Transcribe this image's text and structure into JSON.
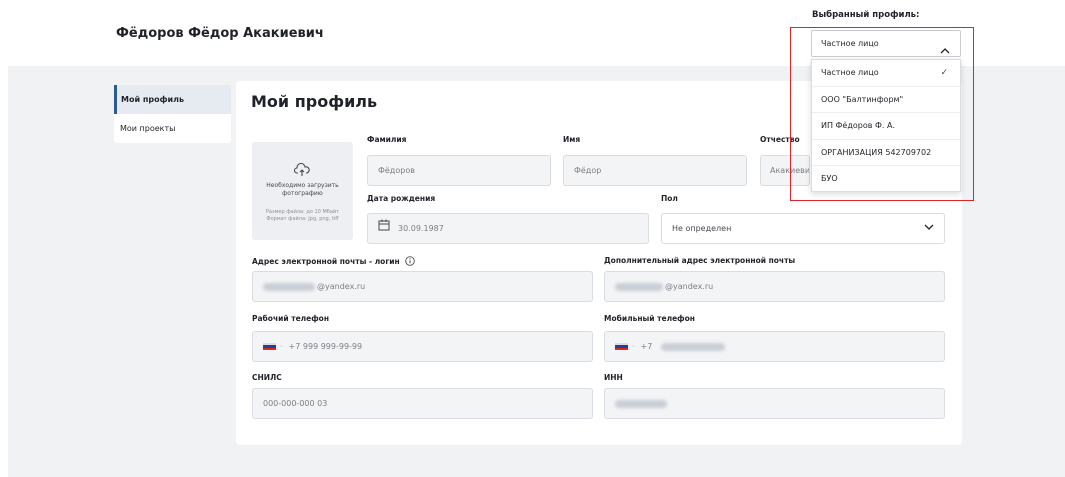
{
  "header": {
    "user_name": "Фёдоров Фёдор Акакиевич",
    "profile_label": "Выбранный профиль:",
    "selected_profile": "Частное лицо"
  },
  "profile_menu": {
    "items": [
      {
        "label": "Частное лицо",
        "selected": true
      },
      {
        "label": "ООО \"Балтинформ\"",
        "selected": false
      },
      {
        "label": "ИП Фёдоров Ф. А.",
        "selected": false
      },
      {
        "label": "ОРГАНИЗАЦИЯ 542709702",
        "selected": false
      },
      {
        "label": "БУО",
        "selected": false
      }
    ],
    "check_glyph": "✓"
  },
  "sidebar": {
    "items": [
      {
        "label": "Мой профиль",
        "active": true
      },
      {
        "label": "Мои проекты",
        "active": false
      }
    ]
  },
  "main": {
    "title": "Мой профиль",
    "photo": {
      "hint": "Необходимо загрузить фотографию",
      "size_note": "Размер файла: до 10 Мбайт",
      "format_note": "Формат файла: jpg, png, tiff"
    },
    "fields": {
      "lastname_label": "Фамилия",
      "lastname_value": "Фёдоров",
      "firstname_label": "Имя",
      "firstname_value": "Фёдор",
      "patronymic_label": "Отчество",
      "patronymic_value": "Акакиевич",
      "birthdate_label": "Дата рождения",
      "birthdate_value": "30.09.1987",
      "gender_label": "Пол",
      "gender_value": "Не определен",
      "email_label": "Адрес электронной почты - логин",
      "email_value": "@yandex.ru",
      "email2_label": "Дополнительный адрес электронной почты",
      "email2_value": "@yandex.ru",
      "work_phone_label": "Рабочий телефон",
      "work_phone_value": "+7 999 999-99-99",
      "mobile_phone_label": "Мобильный телефон",
      "mobile_phone_value": "+7",
      "snils_label": "СНИЛС",
      "snils_value": "000-000-000 03",
      "inn_label": "ИНН"
    }
  },
  "colors": {
    "accent": "#2f5a8e",
    "highlight_border": "#d9262b",
    "band_bg": "#f0f2f4"
  }
}
